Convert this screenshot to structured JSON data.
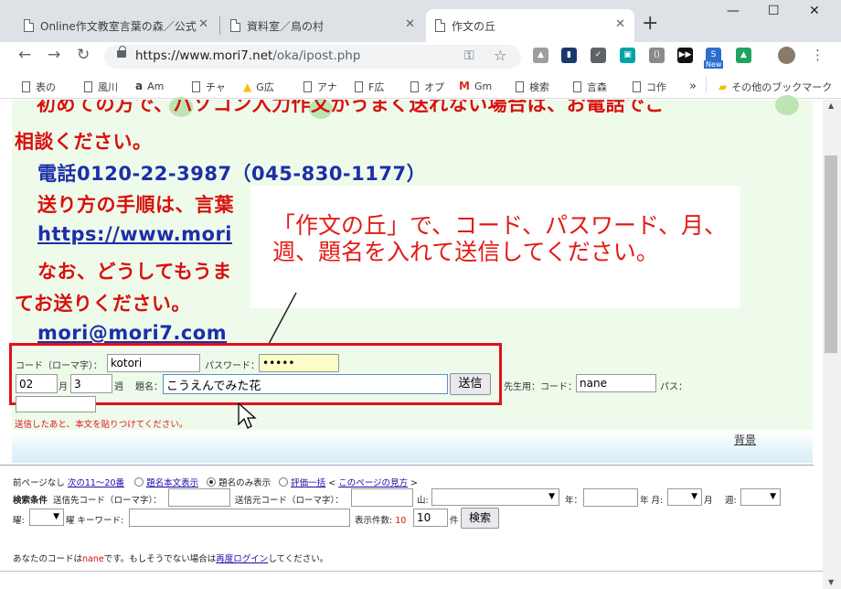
{
  "browser": {
    "tabs": [
      {
        "title": "Online作文教室言葉の森／公式",
        "active": false
      },
      {
        "title": "資料室／鳥の村",
        "active": false
      },
      {
        "title": "作文の丘",
        "active": true
      }
    ],
    "new_tab": "+",
    "window_controls": {
      "minimize": "—",
      "maximize": "☐",
      "close": "✕"
    },
    "url_prefix": "https://www.mori7.net",
    "url_path": "/oka/ipost.php",
    "bookmarks": [
      {
        "label": "表の",
        "icon": "page-icon"
      },
      {
        "label": "風川",
        "icon": "page-icon"
      },
      {
        "label": "Am",
        "icon": "amazon-icon"
      },
      {
        "label": "チャ",
        "icon": "page-icon"
      },
      {
        "label": "G広",
        "icon": "google-ads-icon"
      },
      {
        "label": "アナ",
        "icon": "page-icon"
      },
      {
        "label": "F広",
        "icon": "page-icon"
      },
      {
        "label": "オプ",
        "icon": "page-icon"
      },
      {
        "label": "Gm",
        "icon": "gmail-icon"
      },
      {
        "label": "検索",
        "icon": "page-icon"
      },
      {
        "label": "言森",
        "icon": "page-icon"
      },
      {
        "label": "コ作",
        "icon": "page-icon"
      }
    ],
    "bookmarks_more": "»",
    "other_bookmarks": "その他のブックマーク",
    "extension_new_badge": "New"
  },
  "page": {
    "line1": "初めての方で、パソコン入力作文がうまく送れない場合は、お電話でご",
    "line2": "相談ください。",
    "phone": "電話0120-22-3987（045-830-1177）",
    "line4": "送り方の手順は、言葉",
    "link_url": "https://www.mori",
    "line6": "なお、どうしてもうま",
    "line7": "てお送りください。",
    "email": "mori@mori7.com",
    "callout": "「作文の丘」で、コード、パスワード、月、週、題名を入れて送信してください。",
    "form": {
      "code_label": "コード（ローマ字）：",
      "code_value": "kotori",
      "password_label": "パスワード：",
      "password_value": "•••••",
      "month_value": "02",
      "month_label": "月",
      "week_value": "3",
      "week_label": "週",
      "title_label": "題名：",
      "title_value": "こうえんでみた花",
      "send_label": "送信",
      "teacher_label": "先生用：コード：",
      "teacher_value": "nane",
      "pass_label": "パス：",
      "note": "送信したあと、本文を貼りつけてください。"
    },
    "background_link": "背景",
    "nav": {
      "prev": "前ページなし",
      "next": "次の11〜20番",
      "opt1": "題名本文表示",
      "opt2": "題名のみ表示",
      "opt3": "評価一括",
      "guide_pre": "<",
      "guide": "このページの見方",
      "guide_post": ">"
    },
    "search": {
      "label": "検索条件",
      "to_code": "送信先コード（ローマ字）：",
      "from_code": "送信元コード（ローマ字）：",
      "mountain": "山:",
      "year": "年：",
      "month": "年 月:",
      "month2": "月",
      "week": "週:",
      "weekday": "曜:",
      "weekday2": "曜 キーワード:",
      "count_label": "表示件数:",
      "count_red": "10",
      "count_value": "10",
      "count_unit": "件",
      "search_btn": "検索"
    },
    "footer": {
      "pre": "あなたのコードは",
      "code": "nane",
      "mid": "です。もしそうでない場合は",
      "link": "再度ログイン",
      "post": "してください。"
    }
  }
}
